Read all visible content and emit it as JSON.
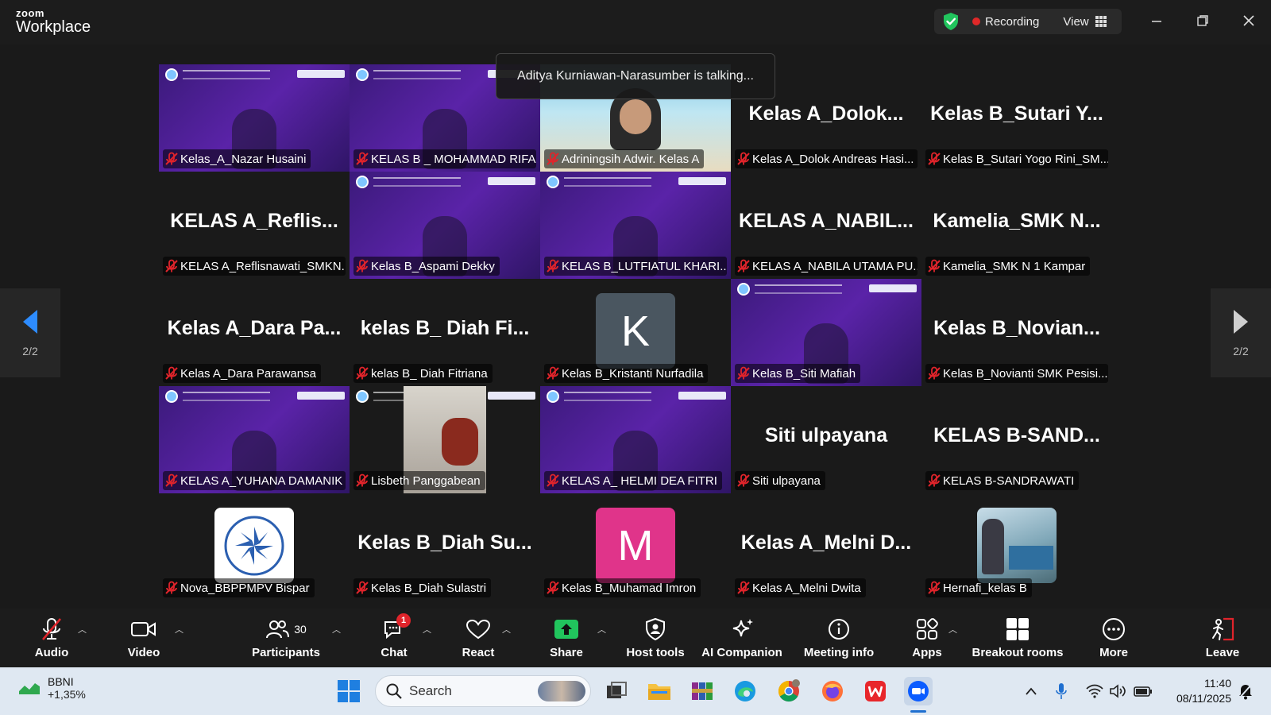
{
  "app": {
    "brand_top": "zoom",
    "brand_bottom": "Workplace"
  },
  "titlebar": {
    "recording_label": "Recording",
    "view_label": "View"
  },
  "talking_banner": "Aditya Kurniawan-Narasumber is talking...",
  "pager": {
    "left": "2/2",
    "right": "2/2"
  },
  "tiles": [
    {
      "label": "Kelas_A_Nazar Husaini",
      "display": "",
      "kind": "video"
    },
    {
      "label": "KELAS B _ MOHAMMAD RIFAI",
      "display": "",
      "kind": "video"
    },
    {
      "label": "Adriningsih Adwir. Kelas A",
      "display": "",
      "kind": "video-beach"
    },
    {
      "label": "Kelas A_Dolok Andreas Hasi...",
      "display": "Kelas A_Dolok...",
      "kind": "name"
    },
    {
      "label": "Kelas B_Sutari Yogo Rini_SM...",
      "display": "Kelas B_Sutari Y...",
      "kind": "name"
    },
    {
      "label": "KELAS A_Reflisnawati_SMKN...",
      "display": "KELAS A_Reflis...",
      "kind": "name"
    },
    {
      "label": "Kelas B_Aspami Dekky",
      "display": "",
      "kind": "video"
    },
    {
      "label": "KELAS B_LUTFIATUL KHARI...",
      "display": "",
      "kind": "video"
    },
    {
      "label": "KELAS A_NABILA UTAMA PU...",
      "display": "KELAS A_NABIL...",
      "kind": "name"
    },
    {
      "label": "Kamelia_SMK N 1 Kampar",
      "display": "Kamelia_SMK N...",
      "kind": "name"
    },
    {
      "label": "Kelas A_Dara Parawansa",
      "display": "Kelas A_Dara Pa...",
      "kind": "name"
    },
    {
      "label": "kelas B_ Diah Fitriana",
      "display": "kelas B_ Diah Fi...",
      "kind": "name"
    },
    {
      "label": "Kelas B_Kristanti Nurfadila",
      "display": "K",
      "kind": "avatar-k"
    },
    {
      "label": "Kelas B_Siti Mafiah",
      "display": "",
      "kind": "video"
    },
    {
      "label": "Kelas B_Novianti SMK Pesisi...",
      "display": "Kelas B_Novian...",
      "kind": "name"
    },
    {
      "label": "KELAS A_YUHANA DAMANIK",
      "display": "",
      "kind": "video"
    },
    {
      "label": "Lisbeth Panggabean",
      "display": "",
      "kind": "video-room"
    },
    {
      "label": "KELAS A_ HELMI DEA FITRI",
      "display": "",
      "kind": "video"
    },
    {
      "label": "Siti ulpayana",
      "display": "Siti ulpayana",
      "kind": "name"
    },
    {
      "label": "KELAS B-SANDRAWATI",
      "display": "KELAS B-SAND...",
      "kind": "name"
    },
    {
      "label": "Nova_BBPPMPV Bispar",
      "display": "",
      "kind": "avatar-logo"
    },
    {
      "label": "Kelas B_Diah Sulastri",
      "display": "Kelas B_Diah Su...",
      "kind": "name"
    },
    {
      "label": "Kelas B_Muhamad Imron",
      "display": "M",
      "kind": "avatar-m"
    },
    {
      "label": "Kelas A_Melni Dwita",
      "display": "Kelas A_Melni D...",
      "kind": "name"
    },
    {
      "label": "Hernafi_kelas B",
      "display": "",
      "kind": "avatar-photo"
    }
  ],
  "toolbar": {
    "audio": "Audio",
    "video": "Video",
    "participants": "Participants",
    "participants_count": "30",
    "chat": "Chat",
    "chat_badge": "1",
    "react": "React",
    "share": "Share",
    "host_tools": "Host tools",
    "ai_companion": "AI Companion",
    "meeting_info": "Meeting info",
    "apps": "Apps",
    "breakout_rooms": "Breakout rooms",
    "more": "More",
    "leave": "Leave"
  },
  "taskbar": {
    "stock_name": "BBNI",
    "stock_change": "+1,35%",
    "search_placeholder": "Search",
    "time": "11:40",
    "date": "08/11/2025"
  },
  "colors": {
    "accent_blue": "#2d8cff",
    "share_green": "#21c55d",
    "recording_red": "#e02828",
    "avatar_k": "#4a5660",
    "avatar_m": "#e0348a",
    "tile_purple": "#4a1f95"
  }
}
